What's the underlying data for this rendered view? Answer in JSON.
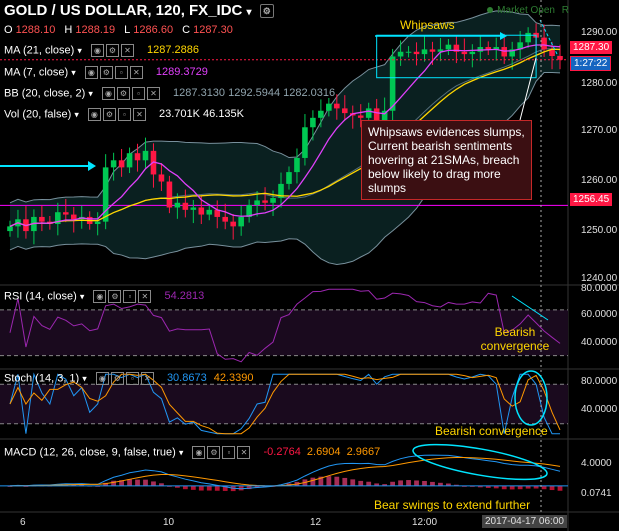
{
  "header": {
    "title": "GOLD / US DOLLAR, 120, FX_IDC",
    "ohlc": [
      {
        "k": "O",
        "v": "1288.10"
      },
      {
        "k": "H",
        "v": "1288.19"
      },
      {
        "k": "L",
        "v": "1286.60"
      },
      {
        "k": "C",
        "v": "1287.30"
      }
    ],
    "market_status": "Market Open",
    "market_scale": "R"
  },
  "indicators": [
    {
      "name": "MA (21, close)",
      "values": "1287.2886",
      "color": "#ffd600"
    },
    {
      "name": "MA (7, close)",
      "values": "1289.3729",
      "color": "#e040fb"
    },
    {
      "name": "BB (20, close, 2)",
      "values": "1287.3130  1292.5944  1282.0316",
      "color": "#546e7a"
    },
    {
      "name": "Vol (20, false)",
      "values": "23.701K  46.135K",
      "color": "#ffffff"
    }
  ],
  "rsi_panel": {
    "label": "RSI (14, close)",
    "value": "54.2813",
    "color": "#9c27b0"
  },
  "stoch_panel": {
    "label": "Stoch (14, 3, 1)",
    "k": "30.8673",
    "d": "42.3390"
  },
  "macd_panel": {
    "label": "MACD (12, 26, close, 9, false, true)",
    "v1": "-0.2764",
    "v2": "2.6904",
    "v3": "2.9667"
  },
  "annotations": {
    "whipsaws": "Whipsaws",
    "note": "Whipsaws evidences slumps, Current bearish sentiments hovering at 21SMAs, breach below likely to drag more slumps",
    "rsi_note": "Bearish convergence",
    "stoch_note": "Bearish convergence",
    "macd_note": "Bear swings to extend further"
  },
  "price_axis": {
    "ticks": [
      "1290.00",
      "1280.00",
      "1270.00",
      "1260.00",
      "1250.00",
      "1240.00"
    ],
    "last_price": "1287.30",
    "countdown": "1:27:22",
    "level": "1256.45"
  },
  "rsi_axis": {
    "ticks": [
      "80.0000",
      "60.0000",
      "40.0000"
    ]
  },
  "stoch_axis": {
    "ticks": [
      "80.0000",
      "40.0000"
    ]
  },
  "macd_axis": {
    "ticks": [
      "4.0000",
      "0.0741"
    ]
  },
  "time_axis": {
    "labels": [
      "6",
      "10",
      "12",
      "12:00"
    ],
    "current": "2017-04-17 06:00"
  },
  "colors": {
    "up": "#00c853",
    "down": "#ff1744",
    "ma21": "#ffd600",
    "ma7": "#e040fb",
    "bb": "#546e7a",
    "rsi": "#9c27b0",
    "stoch_k": "#2196f3",
    "stoch_d": "#ff9800",
    "macd": "#2196f3",
    "signal": "#ff9800",
    "level": "#ff00ff",
    "accent": "#00e5ff"
  },
  "chart_data": {
    "type": "candlestick",
    "title": "GOLD / US DOLLAR, 120, FX_IDC",
    "x_labels": [
      "6",
      "10",
      "12",
      "12:00"
    ],
    "ylim": [
      1240,
      1300
    ],
    "price_levels": {
      "last": 1287.3,
      "horizontal_level": 1256.45
    },
    "close": [
      1252.0,
      1253.5,
      1251.0,
      1254.0,
      1253.0,
      1252.5,
      1255.0,
      1254.5,
      1253.5,
      1254.0,
      1252.5,
      1253.0,
      1264.5,
      1266.0,
      1264.5,
      1267.5,
      1266.0,
      1268.0,
      1263.0,
      1261.5,
      1256.0,
      1257.0,
      1255.5,
      1256.0,
      1254.5,
      1255.5,
      1254.0,
      1253.0,
      1252.0,
      1254.0,
      1256.5,
      1257.5,
      1257.0,
      1258.0,
      1261.0,
      1263.5,
      1266.5,
      1273.0,
      1275.0,
      1276.5,
      1278.0,
      1277.0,
      1276.0,
      1275.5,
      1275.0,
      1277.0,
      1274.0,
      1276.5,
      1288.0,
      1289.0,
      1289.0,
      1288.5,
      1289.5,
      1289.0,
      1289.5,
      1290.5,
      1289.0,
      1288.5,
      1289.0,
      1290.0,
      1289.5,
      1290.0,
      1288.0,
      1289.5,
      1291.0,
      1293.0,
      1292.0,
      1289.5,
      1288.1,
      1287.3
    ]
  }
}
